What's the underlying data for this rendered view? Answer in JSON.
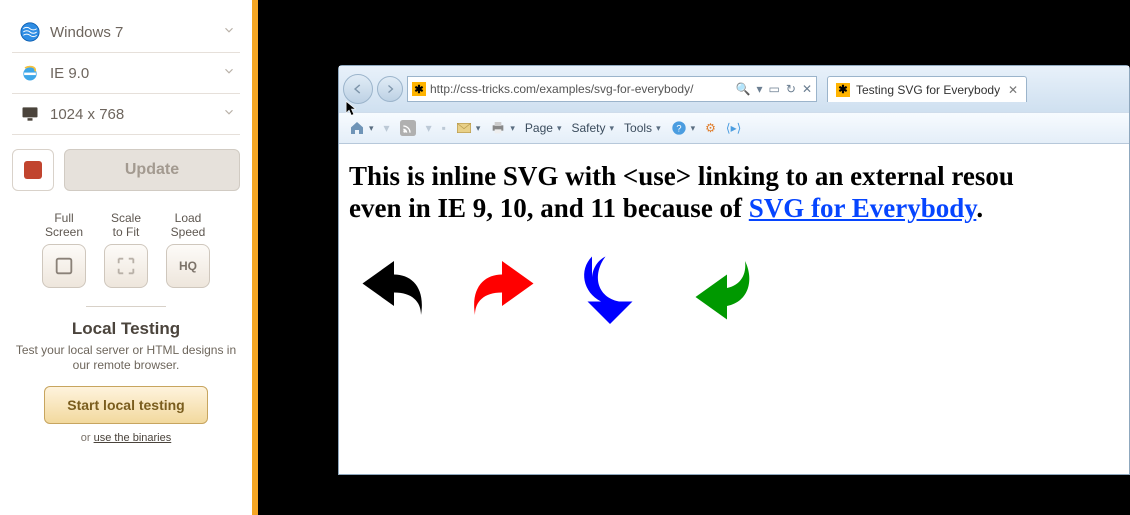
{
  "sidebar": {
    "os": "Windows 7",
    "browser": "IE 9.0",
    "resolution": "1024 x 768",
    "update_label": "Update",
    "tools": {
      "fullscreen_label": "Full\nScreen",
      "scale_label": "Scale\nto Fit",
      "speed_label": "Load\nSpeed",
      "speed_badge": "HQ"
    },
    "local": {
      "title": "Local Testing",
      "desc": "Test your local server or HTML designs in our remote browser.",
      "button_label": "Start local testing",
      "binaries_prefix": "or ",
      "binaries_link": "use the binaries"
    }
  },
  "ie": {
    "url": "http://css-tricks.com/examples/svg-for-everybody/",
    "tab_title": "Testing SVG for Everybody",
    "toolbar": {
      "page": "Page",
      "safety": "Safety",
      "tools": "Tools"
    },
    "content": {
      "heading_part1": "This is inline SVG with <use> linking to an external resou",
      "heading_part2": "even in IE 9, 10, and 11 because of ",
      "link_text": "SVG for Everybody",
      "period": "."
    },
    "arrow_colors": [
      "#000000",
      "#ff0000",
      "#0000ff",
      "#009900"
    ]
  }
}
